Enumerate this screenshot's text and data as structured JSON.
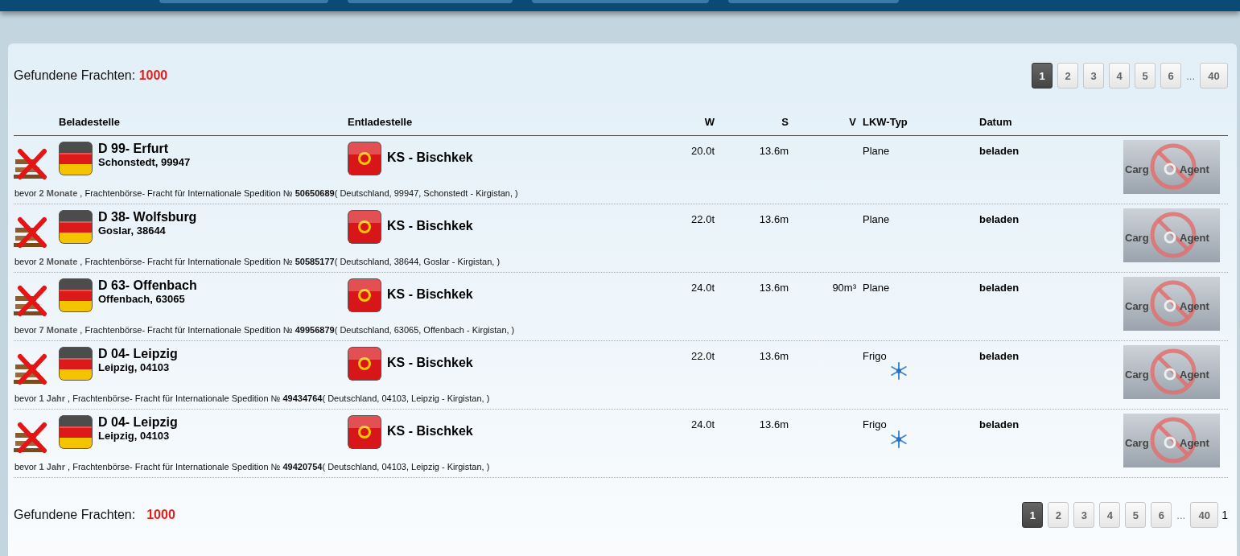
{
  "summary_top": {
    "label": "Gefundene Frachten:",
    "count": "1000"
  },
  "pagination_top": {
    "pages": [
      {
        "label": "1",
        "selected": true
      },
      {
        "label": "2",
        "selected": false
      },
      {
        "label": "3",
        "selected": false
      },
      {
        "label": "4",
        "selected": false
      },
      {
        "label": "5",
        "selected": false
      },
      {
        "label": "6",
        "selected": false
      }
    ],
    "ellipsis": "...",
    "last": "40"
  },
  "table": {
    "columns": [
      "Beladestelle",
      "Entladestelle",
      "W",
      "S",
      "V",
      "LKW-Typ",
      "Datum"
    ],
    "rows": [
      {
        "load_title": "D 99- Erfurt",
        "load_place": "Schonstedt, 99947",
        "unload": "KS - Bischkek",
        "weight": "20.0t",
        "length": "13.6m",
        "volume": "",
        "truck": "Plane",
        "refrigerated": false,
        "date": "beladen",
        "age_prefix": "bevor",
        "age": "2 Monate",
        "info": ", Frachtenbörse- Fracht für Internationale Spedition №",
        "number": "50650689",
        "route": "( Deutschland, 99947, Schonstedt - Kirgistan,  )",
        "logo": [
          "Carg",
          "Agent"
        ]
      },
      {
        "load_title": "D 38- Wolfsburg",
        "load_place": "Goslar, 38644",
        "unload": "KS - Bischkek",
        "weight": "22.0t",
        "length": "13.6m",
        "volume": "",
        "truck": "Plane",
        "refrigerated": false,
        "date": "beladen",
        "age_prefix": "bevor",
        "age": "2 Monate",
        "info": ", Frachtenbörse- Fracht für Internationale Spedition №",
        "number": "50585177",
        "route": "( Deutschland, 38644, Goslar - Kirgistan,  )",
        "logo": [
          "Carg",
          "Agent"
        ]
      },
      {
        "load_title": "D 63- Offenbach",
        "load_place": "Offenbach, 63065",
        "unload": "KS - Bischkek",
        "weight": "24.0t",
        "length": "13.6m",
        "volume": "90m³",
        "truck": "Plane",
        "refrigerated": false,
        "date": "beladen",
        "age_prefix": "bevor",
        "age": "7 Monate",
        "info": ", Frachtenbörse- Fracht für Internationale Spedition №",
        "number": "49956879",
        "route": "( Deutschland, 63065, Offenbach - Kirgistan,  )",
        "logo": [
          "Carg",
          "Agent"
        ]
      },
      {
        "load_title": "D 04- Leipzig",
        "load_place": "Leipzig, 04103",
        "unload": "KS - Bischkek",
        "weight": "22.0t",
        "length": "13.6m",
        "volume": "",
        "truck": "Frigo",
        "refrigerated": true,
        "date": "beladen",
        "age_prefix": "bevor",
        "age": "1 Jahr",
        "info": ", Frachtenbörse- Fracht für Internationale Spedition №",
        "number": "49434764",
        "route": "( Deutschland, 04103, Leipzig - Kirgistan,  )",
        "logo": [
          "Carg",
          "Agent"
        ]
      },
      {
        "load_title": "D 04- Leipzig",
        "load_place": "Leipzig, 04103",
        "unload": "KS - Bischkek",
        "weight": "24.0t",
        "length": "13.6m",
        "volume": "",
        "truck": "Frigo",
        "refrigerated": true,
        "date": "beladen",
        "age_prefix": "bevor",
        "age": "1 Jahr",
        "info": ", Frachtenbörse- Fracht für Internationale Spedition №",
        "number": "49420754",
        "route": "( Deutschland, 04103, Leipzig - Kirgistan,  )",
        "logo": [
          "Carg",
          "Agent"
        ]
      }
    ]
  },
  "summary_bottom": {
    "label": "Gefundene Frachten:",
    "count": "1000"
  },
  "pagination_bottom": {
    "pages": [
      {
        "label": "1",
        "selected": true
      },
      {
        "label": "2",
        "selected": false
      },
      {
        "label": "3",
        "selected": false
      },
      {
        "label": "4",
        "selected": false
      },
      {
        "label": "5",
        "selected": false
      },
      {
        "label": "6",
        "selected": false
      }
    ],
    "ellipsis": "...",
    "last": "40",
    "trailing": "1"
  }
}
